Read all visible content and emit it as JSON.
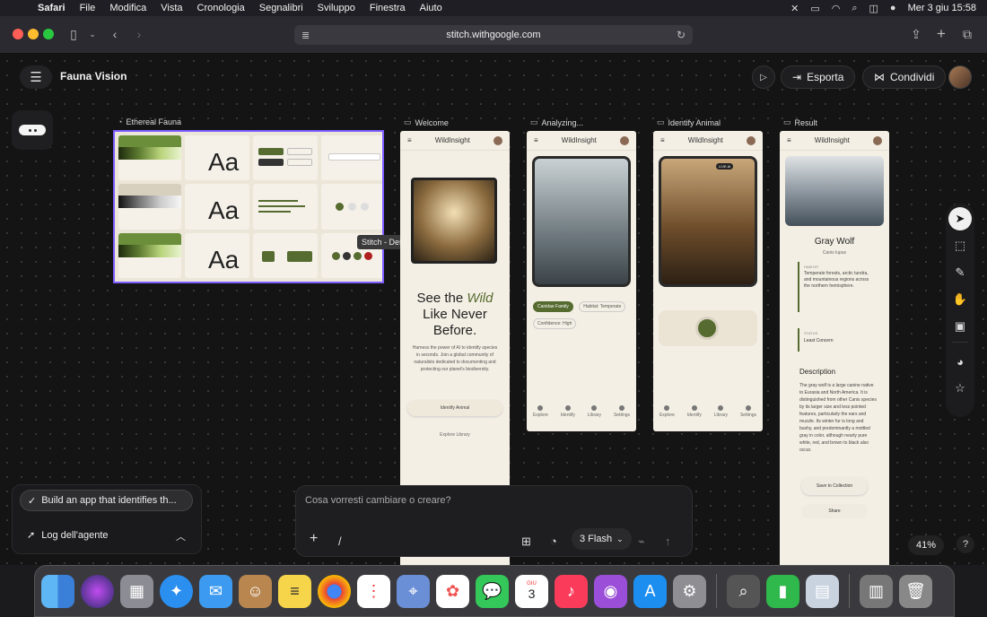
{
  "menubar": {
    "app": "Safari",
    "items": [
      "File",
      "Modifica",
      "Vista",
      "Cronologia",
      "Segnalibri",
      "Sviluppo",
      "Finestra",
      "Aiuto"
    ],
    "datetime": "Mer 3 giu  15:58"
  },
  "browser": {
    "url": "stitch.withgoogle.com"
  },
  "header": {
    "project_title": "Fauna Vision",
    "export_label": "Esporta",
    "share_label": "Condividi"
  },
  "frames": {
    "design_system_label": "Ethereal Fauna",
    "welcome_label": "Welcome",
    "analyzing_label": "Analyzing...",
    "identify_label": "Identify Animal",
    "result_label": "Result"
  },
  "tooltip": "Stitch - Design with AI",
  "welcome": {
    "app_name": "WildInsight",
    "headline_1": "See the",
    "headline_wild": "Wild",
    "headline_2": "Like Never",
    "headline_3": "Before.",
    "body": "Harness the power of AI to identify species in seconds. Join a global community of naturalists dedicated to documenting and protecting our planet's biodiversity.",
    "cta_identify": "Identify Animal",
    "cta_library": "Explore Library"
  },
  "analyzing": {
    "app_name": "WildInsight",
    "tags": [
      "Canidae Family",
      "Habitat: Temperate",
      "Confidence: High"
    ]
  },
  "identify": {
    "app_name": "WildInsight",
    "live_badge": "LIVE AI"
  },
  "result": {
    "app_name": "WildInsight",
    "animal_name": "Gray Wolf",
    "scientific": "Canis lupus",
    "habitat_label": "HABITAT",
    "habitat_text": "Temperate forests, arctic tundra, and mountainous regions across the northern hemisphere.",
    "status_label": "STATUS",
    "status_text": "Least Concern",
    "description_title": "Description",
    "description": "The gray wolf is a large canine native to Eurasia and North America. It is distinguished from other Canis species by its larger size and less pointed features, particularly the ears and muzzle. Its winter fur is long and bushy, and predominantly a mottled gray in color, although nearly pure white, red, and brown to black also occur.",
    "save_label": "Save to Collection",
    "share_label": "Share"
  },
  "nav_items": [
    "Explore",
    "Identify",
    "Library",
    "Settings"
  ],
  "agent": {
    "task": "Build an app that identifies th...",
    "log_label": "Log dell'agente"
  },
  "prompt": {
    "placeholder": "Cosa vorresti cambiare o creare?",
    "model": "3 Flash"
  },
  "zoom": "41%",
  "dock_calendar": {
    "month": "GIU",
    "day": "3"
  },
  "colors": {
    "accent": "#7c5cff",
    "brand_green": "#556b2f"
  }
}
